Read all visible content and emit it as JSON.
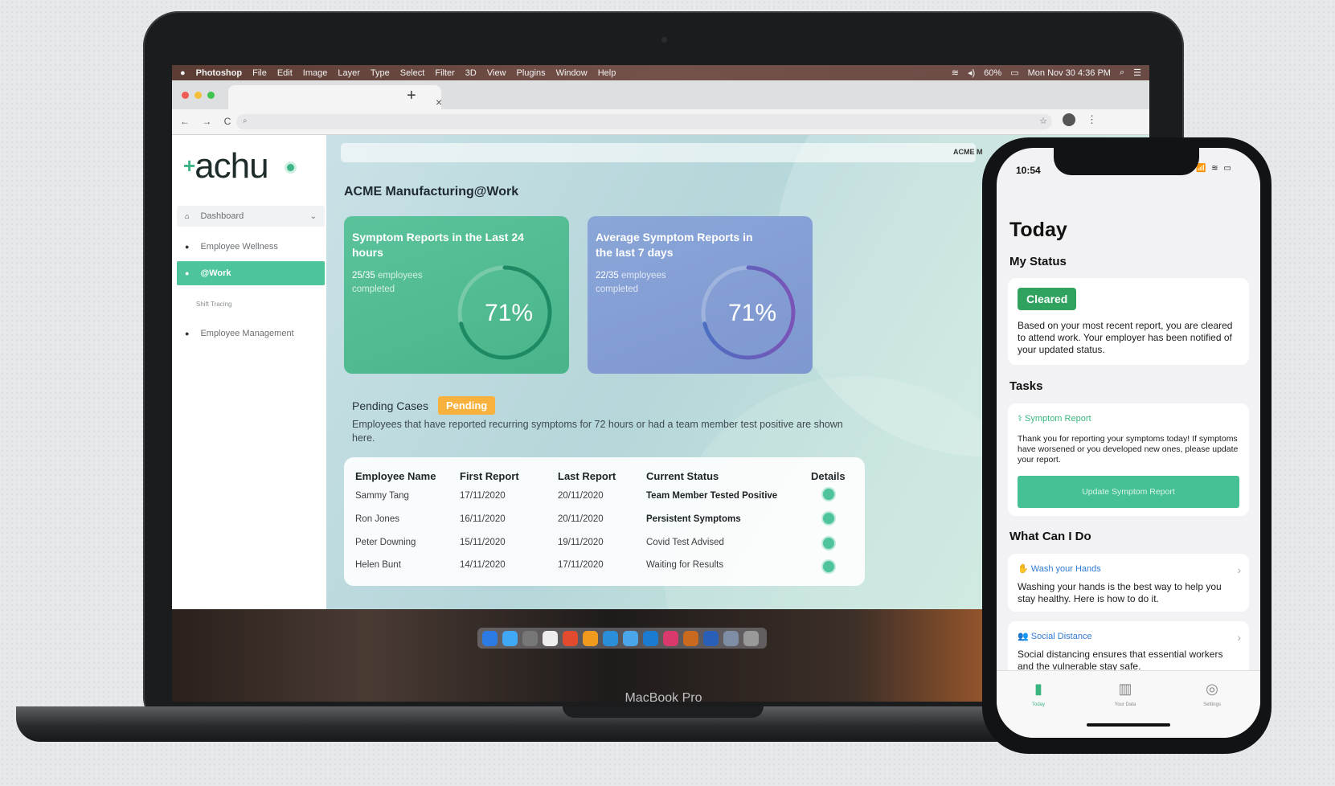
{
  "menubar": {
    "apple": "",
    "app": "Photoshop",
    "items": [
      "File",
      "Edit",
      "Image",
      "Layer",
      "Type",
      "Select",
      "Filter",
      "3D",
      "View",
      "Plugins",
      "Window",
      "Help"
    ],
    "battery": "60%",
    "datetime": "Mon Nov 30 4:36 PM"
  },
  "browser": {
    "tab_close": "×",
    "tab_new": "+",
    "nav": "← → C",
    "address": "⌕",
    "star": "☆",
    "menu": "⋮"
  },
  "sidebar": {
    "logo": "achu",
    "logo_plus": "+",
    "items": [
      {
        "label": "Dashboard",
        "icon": "home-icon"
      },
      {
        "label": "Employee Wellness",
        "icon": "bullet-icon"
      },
      {
        "label": "@Work",
        "icon": "bullet-icon"
      },
      {
        "label": "Employee Management",
        "icon": "bullet-icon"
      }
    ],
    "sub_item": "Shift Tracing"
  },
  "header": {
    "right_label": "ACME M",
    "company": "ACME Manufacturing@Work"
  },
  "cards": [
    {
      "title": "Symptom Reports in the Last 24 hours",
      "count": "25/35",
      "count_suffix": " employees completed",
      "percent": "71%",
      "progress": 0.71
    },
    {
      "title": "Average Symptom Reports in the last 7 days",
      "count": "22/35",
      "count_suffix": " employees completed",
      "percent": "71%",
      "progress": 0.71
    }
  ],
  "pending": {
    "title": "Pending Cases",
    "badge": "Pending",
    "description": "Employees that have reported recurring symptoms for 72 hours or had a team member test positive are shown here."
  },
  "table": {
    "headers": [
      "Employee Name",
      "First Report",
      "Last Report",
      "Current Status",
      "Details"
    ],
    "rows": [
      {
        "name": "Sammy Tang",
        "first": "17/11/2020",
        "last": "20/11/2020",
        "status": "Team Member Tested Positive"
      },
      {
        "name": "Ron Jones",
        "first": "16/11/2020",
        "last": "20/11/2020",
        "status": "Persistent Symptoms"
      },
      {
        "name": "Peter Downing",
        "first": "15/11/2020",
        "last": "19/11/2020",
        "status": "Covid Test Advised"
      },
      {
        "name": "Helen Bunt",
        "first": "14/11/2020",
        "last": "17/11/2020",
        "status": "Waiting for Results"
      }
    ]
  },
  "laptop": {
    "label": "MacBook Pro"
  },
  "phone": {
    "time": "10:54",
    "status_icons": "📶 ≋ ▭",
    "today": "Today",
    "my_status": "My Status",
    "cleared": "Cleared",
    "status_text": "Based on your most recent report, you are cleared to attend work. Your employer has been notified of your updated status.",
    "tasks": "Tasks",
    "task_link": "Symptom Report",
    "task_text": "Thank you for reporting your symptoms today! If symptoms have worsened or you developed new ones, please update your report.",
    "task_button": "Update Symptom Report",
    "what": "What Can I Do",
    "tips": [
      {
        "title": "Wash your Hands",
        "text": "Washing your hands is the best way to help you stay healthy. Here is how to do it."
      },
      {
        "title": "Social Distance",
        "text": "Social distancing ensures that essential workers and the vulnerable stay safe."
      }
    ],
    "tabs": [
      "Today",
      "Your Data",
      "Settings"
    ]
  },
  "colors": {
    "accent": "#4ec49c",
    "card_green": "#5bc39b",
    "card_blue": "#8aa6d8",
    "pending": "#f7b13c",
    "cleared": "#2ea25e",
    "link": "#2f7bd6"
  }
}
